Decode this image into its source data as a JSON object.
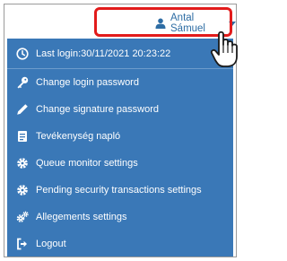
{
  "header": {
    "user_name": "Antal Sámuel",
    "icons": {
      "user": "user-icon",
      "dropdown": "caret-down-icon",
      "cursor": "hand-pointer-icon"
    },
    "highlight_color": "#e21b1b"
  },
  "menu": {
    "background": "#3a78b7",
    "last_login": "Last login:30/11/2021 20:23:22",
    "items": [
      {
        "label": "Change login password",
        "icon": "key-icon"
      },
      {
        "label": "Change signature password",
        "icon": "pencil-icon"
      },
      {
        "label": "Tevékenység napló",
        "icon": "notebook-icon"
      },
      {
        "label": "Queue monitor settings",
        "icon": "gear-icon"
      },
      {
        "label": "Pending security transactions settings",
        "icon": "gear-icon"
      },
      {
        "label": "Allegements settings",
        "icon": "gears-icon"
      },
      {
        "label": "Logout",
        "icon": "sign-out-icon"
      }
    ]
  }
}
